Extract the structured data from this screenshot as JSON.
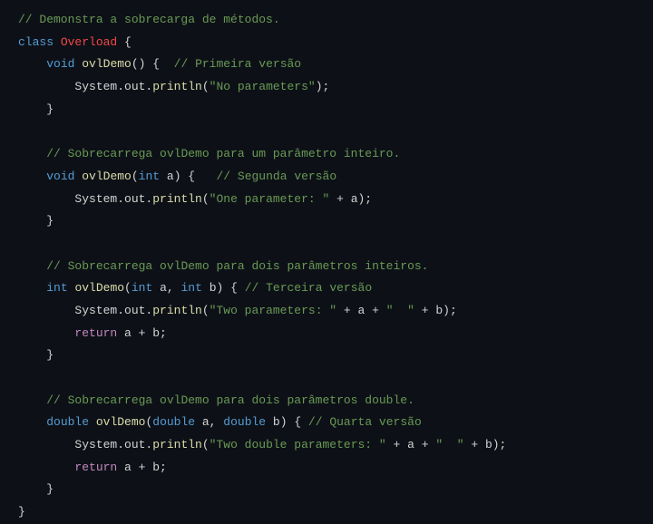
{
  "lines": {
    "l1_comment": "// Demonstra a sobrecarga de métodos.",
    "l2_class": "class",
    "l2_name": "Overload",
    "l2_brace": " {",
    "l3_void": "void",
    "l3_method": "ovlDemo",
    "l3_parens": "() {  ",
    "l3_comment": "// Primeira versão",
    "l4_obj": "System.out.",
    "l4_println": "println",
    "l4_open": "(",
    "l4_str": "\"No parameters\"",
    "l4_close": ");",
    "l5_close": "}",
    "l7_comment": "// Sobrecarrega ovlDemo para um parâmetro inteiro.",
    "l8_void": "void",
    "l8_method": "ovlDemo",
    "l8_open": "(",
    "l8_int": "int",
    "l8_a": " a",
    "l8_close": ") {   ",
    "l8_comment": "// Segunda versão",
    "l9_obj": "System.out.",
    "l9_println": "println",
    "l9_open": "(",
    "l9_str": "\"One parameter: \"",
    "l9_plus": " + a);",
    "l10_close": "}",
    "l12_comment": "// Sobrecarrega ovlDemo para dois parâmetros inteiros.",
    "l13_int": "int",
    "l13_method": "ovlDemo",
    "l13_open": "(",
    "l13_int1": "int",
    "l13_a": " a, ",
    "l13_int2": "int",
    "l13_b": " b) { ",
    "l13_comment": "// Terceira versão",
    "l14_obj": "System.out.",
    "l14_println": "println",
    "l14_open": "(",
    "l14_str1": "\"Two parameters: \"",
    "l14_plus1": " + a + ",
    "l14_str2": "\"  \"",
    "l14_plus2": " + b);",
    "l15_return": "return",
    "l15_expr": " a + b;",
    "l16_close": "}",
    "l18_comment": "// Sobrecarrega ovlDemo para dois parâmetros double.",
    "l19_double": "double",
    "l19_method": "ovlDemo",
    "l19_open": "(",
    "l19_d1": "double",
    "l19_a": " a, ",
    "l19_d2": "double",
    "l19_b": " b) { ",
    "l19_comment": "// Quarta versão",
    "l20_obj": "System.out.",
    "l20_println": "println",
    "l20_open": "(",
    "l20_str1": "\"Two double parameters: \"",
    "l20_plus1": " + a + ",
    "l20_str2": "\"  \"",
    "l20_plus2": " + b);",
    "l21_return": "return",
    "l21_expr": " a + b;",
    "l22_close": "}",
    "l23_close": "}"
  }
}
